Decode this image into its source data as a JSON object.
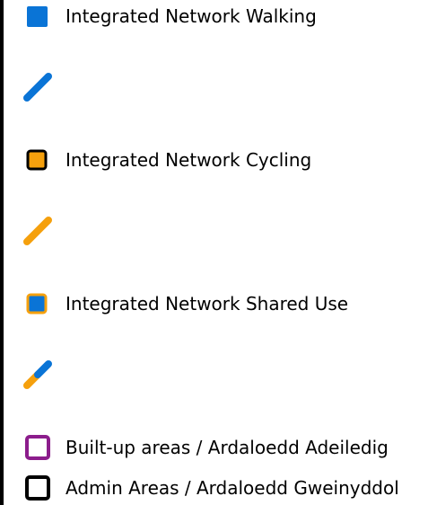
{
  "legend": {
    "items": [
      {
        "label": "Integrated Network Walking",
        "symbol": "square-fill-icon",
        "color": "#0a74d6"
      },
      {
        "label": "",
        "symbol": "line-icon",
        "color": "#0a74d6"
      },
      {
        "label": "Integrated Network Cycling",
        "symbol": "square-outline-fill-icon",
        "color": "#f5a00d",
        "outline": "#000000"
      },
      {
        "label": "",
        "symbol": "line-icon",
        "color": "#f5a00d"
      },
      {
        "label": "Integrated Network Shared Use",
        "symbol": "square-outline-fill-icon",
        "color": "#0a74d6",
        "outline": "#f5a00d"
      },
      {
        "label": "",
        "symbol": "split-line-icon",
        "color": "#0a74d6",
        "secondary": "#f5a00d"
      },
      {
        "label": "Built-up areas / Ardaloedd Adeiledig",
        "symbol": "square-outline-icon",
        "outline": "#8c1d8c"
      },
      {
        "label": "Admin Areas / Ardaloedd Gweinyddol",
        "symbol": "square-outline-icon",
        "outline": "#000000"
      }
    ]
  }
}
